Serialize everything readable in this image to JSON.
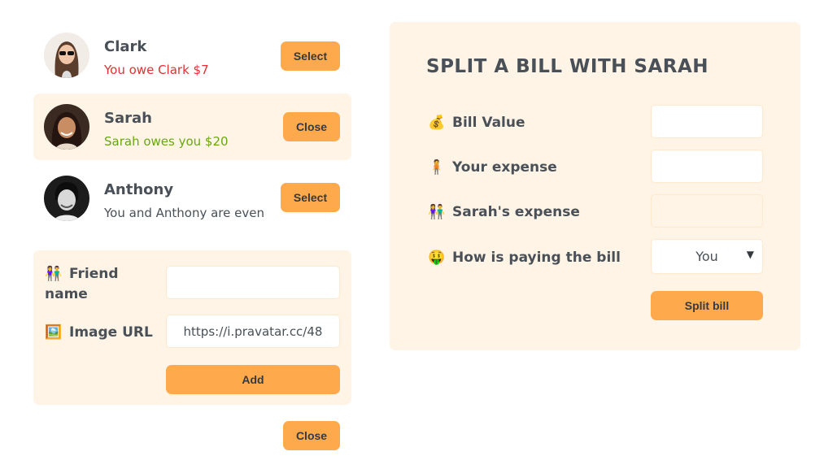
{
  "friends": [
    {
      "name": "Clark",
      "status": "You owe Clark $7",
      "button": "Select"
    },
    {
      "name": "Sarah",
      "status": "Sarah owes you $20",
      "button": "Close"
    },
    {
      "name": "Anthony",
      "status": "You and Anthony are even",
      "button": "Select"
    }
  ],
  "add_form": {
    "name_label_line1": "Friend",
    "name_label_line2": "name",
    "image_label": "Image URL",
    "name_value": "",
    "image_value": "https://i.pravatar.cc/48",
    "add_button": "Add"
  },
  "close_button": "Close",
  "split": {
    "title": "SPLIT A BILL WITH SARAH",
    "bill_label": "Bill Value",
    "your_expense_label": "Your expense",
    "friend_expense_label": "Sarah's expense",
    "payer_label": "How is paying the bill",
    "payer_value": "You",
    "submit_button": "Split bill"
  },
  "colors": {
    "accent": "#ffa94d",
    "panel": "#fff4e6",
    "owe": "#e03131",
    "owed": "#66a80f"
  }
}
